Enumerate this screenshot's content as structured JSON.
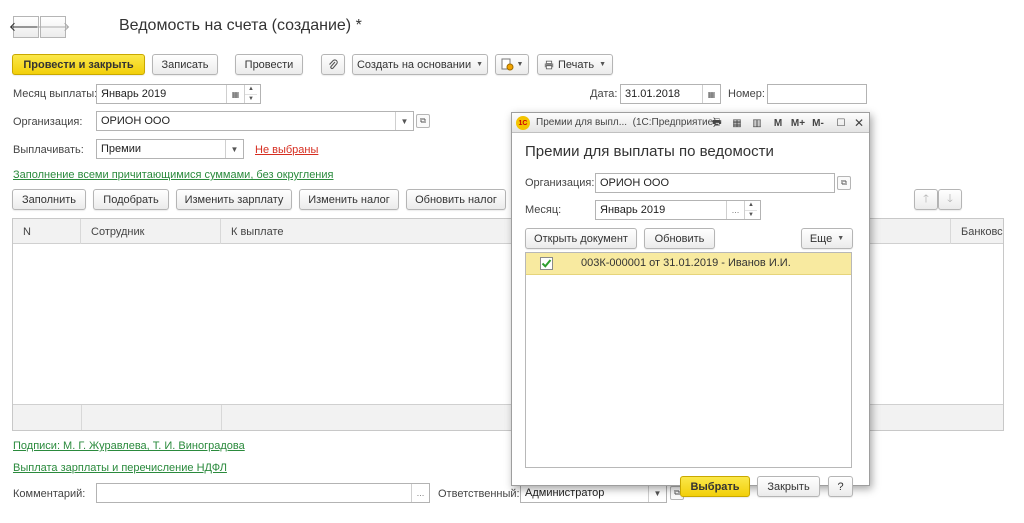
{
  "window": {
    "title": "Ведомость на счета (создание)",
    "modified_mark": "*"
  },
  "nav": {
    "back_glyph": "🡐",
    "forward_glyph": "🡒"
  },
  "toolbar": {
    "post_close": "Провести и закрыть",
    "save": "Записать",
    "post": "Провести",
    "create_based_on": "Создать на основании",
    "print": "Печать"
  },
  "form": {
    "month_label": "Месяц выплаты:",
    "month_value": "Январь 2019",
    "date_label": "Дата:",
    "date_value": "31.01.2018",
    "number_label": "Номер:",
    "number_value": "",
    "org_label": "Организация:",
    "org_value": "ОРИОН ООО",
    "pay_label": "Выплачивать:",
    "pay_value": "Премии",
    "not_selected_link": "Не выбраны",
    "fill_mode_link": "Заполнение всеми причитающимися суммами, без округления"
  },
  "table_toolbar": {
    "fill": "Заполнить",
    "pick": "Подобрать",
    "change_salary": "Изменить зарплату",
    "change_tax": "Изменить налог",
    "update_tax": "Обновить налог"
  },
  "table": {
    "columns": [
      "N",
      "Сотрудник",
      "К выплате",
      "Банковс"
    ]
  },
  "footer": {
    "signatures_link": "Подписи: М. Г. Журавлева, Т. И. Виноградова",
    "payroll_link": "Выплата зарплаты и перечисление НДФЛ",
    "comment_label": "Комментарий:",
    "comment_value": "",
    "responsible_label": "Ответственный:",
    "responsible_value": "Администратор"
  },
  "modal": {
    "window_title": "Премии для выпл...",
    "app_name": "(1С:Предприятие)",
    "title_buttons": [
      "M",
      "M+",
      "M-"
    ],
    "heading": "Премии для выплаты по ведомости",
    "org_label": "Организация:",
    "org_value": "ОРИОН ООО",
    "month_label": "Месяц:",
    "month_value": "Январь 2019",
    "open_doc": "Открыть документ",
    "refresh": "Обновить",
    "more": "Еще",
    "list": [
      {
        "checked": true,
        "text": "003К-000001 от 31.01.2019 - Иванов И.И."
      }
    ],
    "select": "Выбрать",
    "close": "Закрыть",
    "help": "?"
  },
  "colors": {
    "primary_button": "#f2cf0a",
    "link_green": "#2a8a3c",
    "link_red": "#d62d20",
    "selected_row": "#f8eaa0"
  }
}
